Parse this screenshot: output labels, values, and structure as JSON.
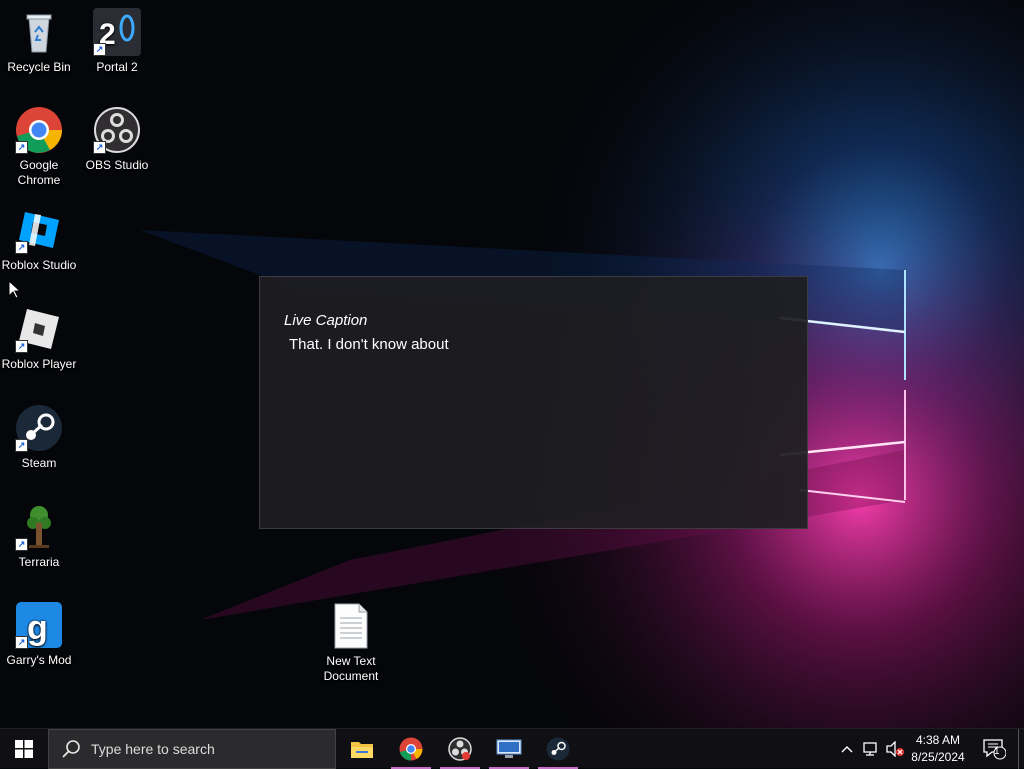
{
  "desktop": {
    "icons": [
      {
        "label": "Recycle Bin",
        "icon": "recycle-bin-icon"
      },
      {
        "label": "Portal 2",
        "icon": "portal2-icon"
      },
      {
        "label": "Google Chrome",
        "icon": "chrome-icon"
      },
      {
        "label": "OBS Studio",
        "icon": "obs-icon"
      },
      {
        "label": "Roblox Studio",
        "icon": "roblox-studio-icon"
      },
      {
        "label": "Roblox Player",
        "icon": "roblox-player-icon"
      },
      {
        "label": "Steam",
        "icon": "steam-icon"
      },
      {
        "label": "Terraria",
        "icon": "terraria-icon"
      },
      {
        "label": "Garry's Mod",
        "icon": "garrys-mod-icon"
      },
      {
        "label": "New Text Document",
        "icon": "text-document-icon"
      }
    ]
  },
  "live_caption": {
    "title": "Live Caption",
    "text": "That. I don't know about"
  },
  "taskbar": {
    "search_placeholder": "Type here to search",
    "pinned": [
      "File Explorer",
      "Google Chrome",
      "OBS Studio",
      "Remote Desktop",
      "Steam"
    ],
    "clock_time": "4:38 AM",
    "clock_date": "8/25/2024",
    "notification_count": "1"
  },
  "colors": {
    "accent_running": "#c770c7",
    "caption_bg": "#1e1e22",
    "taskbar_bg": "#101014"
  }
}
